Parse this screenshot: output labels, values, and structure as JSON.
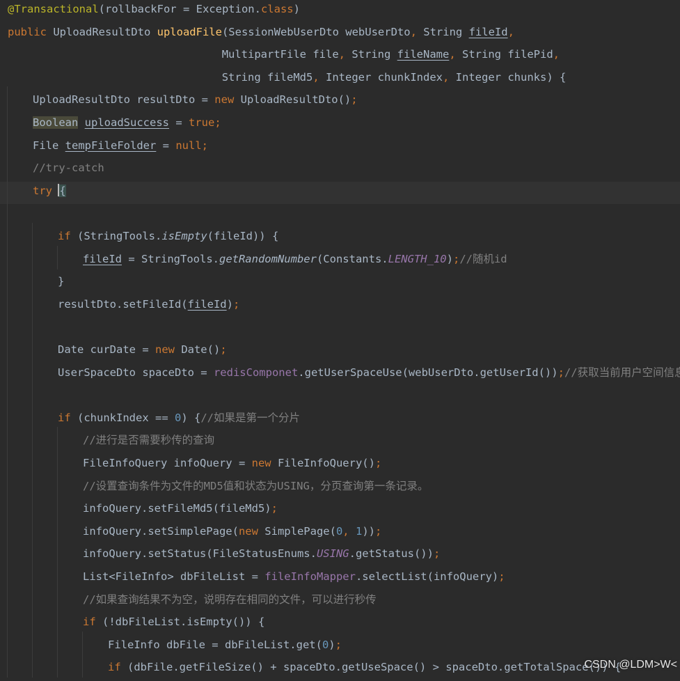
{
  "editor": {
    "lines": [
      {
        "indent": 0,
        "tokens": [
          {
            "t": "@Transactional",
            "c": "ann"
          },
          {
            "t": "(rollbackFor = Exception."
          },
          {
            "t": "class",
            "c": "kw"
          },
          {
            "t": ")"
          }
        ]
      },
      {
        "indent": 0,
        "tokens": [
          {
            "t": "public ",
            "c": "kw"
          },
          {
            "t": "UploadResultDto "
          },
          {
            "t": "uploadFile",
            "c": "fn"
          },
          {
            "t": "(SessionWebUserDto webUserDto"
          },
          {
            "t": ", ",
            "c": "kw"
          },
          {
            "t": "String "
          },
          {
            "t": "fileId",
            "c": "ul"
          },
          {
            "t": ",",
            "c": "kw"
          }
        ]
      },
      {
        "indent": 0,
        "col": 34,
        "tokens": [
          {
            "t": "MultipartFile file"
          },
          {
            "t": ", ",
            "c": "kw"
          },
          {
            "t": "String "
          },
          {
            "t": "fileName",
            "c": "ul"
          },
          {
            "t": ", ",
            "c": "kw"
          },
          {
            "t": "String filePid"
          },
          {
            "t": ",",
            "c": "kw"
          }
        ]
      },
      {
        "indent": 0,
        "col": 34,
        "tokens": [
          {
            "t": "String fileMd5"
          },
          {
            "t": ", ",
            "c": "kw"
          },
          {
            "t": "Integer chunkIndex"
          },
          {
            "t": ", ",
            "c": "kw"
          },
          {
            "t": "Integer chunks) {"
          }
        ]
      },
      {
        "indent": 1,
        "tokens": [
          {
            "t": "UploadResultDto resultDto = "
          },
          {
            "t": "new ",
            "c": "kw"
          },
          {
            "t": "UploadResultDto()"
          },
          {
            "t": ";",
            "c": "kw"
          }
        ]
      },
      {
        "indent": 1,
        "tokens": [
          {
            "t": "Boolean",
            "c": "hl"
          },
          {
            "t": " "
          },
          {
            "t": "uploadSuccess",
            "c": "ul"
          },
          {
            "t": " = "
          },
          {
            "t": "true;",
            "c": "kw"
          }
        ]
      },
      {
        "indent": 1,
        "tokens": [
          {
            "t": "File "
          },
          {
            "t": "tempFileFolder",
            "c": "ul"
          },
          {
            "t": " = "
          },
          {
            "t": "null;",
            "c": "kw"
          }
        ]
      },
      {
        "indent": 1,
        "tokens": [
          {
            "t": "//try-catch",
            "c": "cm"
          }
        ]
      },
      {
        "indent": 1,
        "current": true,
        "tokens": [
          {
            "t": "try ",
            "c": "kw"
          },
          {
            "t": "{",
            "c": "brace",
            "caret": true
          }
        ]
      },
      {
        "indent": 1,
        "tokens": []
      },
      {
        "indent": 2,
        "tokens": [
          {
            "t": "if ",
            "c": "kw"
          },
          {
            "t": "(StringTools."
          },
          {
            "t": "isEmpty",
            "c": "it"
          },
          {
            "t": "(fileId)) {"
          }
        ]
      },
      {
        "indent": 3,
        "tokens": [
          {
            "t": "fileId",
            "c": "ul"
          },
          {
            "t": " = StringTools."
          },
          {
            "t": "getRandomNumber",
            "c": "it"
          },
          {
            "t": "(Constants."
          },
          {
            "t": "LENGTH_10",
            "c": "static"
          },
          {
            "t": ")"
          },
          {
            "t": ";",
            "c": "kw"
          },
          {
            "t": "//随机id",
            "c": "cm"
          }
        ]
      },
      {
        "indent": 2,
        "tokens": [
          {
            "t": "}"
          }
        ]
      },
      {
        "indent": 2,
        "tokens": [
          {
            "t": "resultDto.setFileId("
          },
          {
            "t": "fileId",
            "c": "ul"
          },
          {
            "t": ")"
          },
          {
            "t": ";",
            "c": "kw"
          }
        ]
      },
      {
        "indent": 2,
        "tokens": []
      },
      {
        "indent": 2,
        "tokens": [
          {
            "t": "Date curDate = "
          },
          {
            "t": "new ",
            "c": "kw"
          },
          {
            "t": "Date()"
          },
          {
            "t": ";",
            "c": "kw"
          }
        ]
      },
      {
        "indent": 2,
        "tokens": [
          {
            "t": "UserSpaceDto spaceDto = "
          },
          {
            "t": "redisComponet",
            "c": "field"
          },
          {
            "t": ".getUserSpaceUse(webUserDto.getUserId())"
          },
          {
            "t": ";",
            "c": "kw"
          },
          {
            "t": "//获取当前用户空间信息",
            "c": "cm"
          }
        ]
      },
      {
        "indent": 2,
        "tokens": []
      },
      {
        "indent": 2,
        "tokens": [
          {
            "t": "if ",
            "c": "kw"
          },
          {
            "t": "(chunkIndex == "
          },
          {
            "t": "0",
            "c": "num"
          },
          {
            "t": ") {"
          },
          {
            "t": "//如果是第一个分片",
            "c": "cm"
          }
        ]
      },
      {
        "indent": 3,
        "tokens": [
          {
            "t": "//进行是否需要秒传的查询",
            "c": "cm"
          }
        ]
      },
      {
        "indent": 3,
        "tokens": [
          {
            "t": "FileInfoQuery infoQuery = "
          },
          {
            "t": "new ",
            "c": "kw"
          },
          {
            "t": "FileInfoQuery()"
          },
          {
            "t": ";",
            "c": "kw"
          }
        ]
      },
      {
        "indent": 3,
        "tokens": [
          {
            "t": "//设置查询条件为文件的MD5值和状态为USING，分页查询第一条记录。",
            "c": "cm"
          }
        ]
      },
      {
        "indent": 3,
        "tokens": [
          {
            "t": "infoQuery.setFileMd5(fileMd5)"
          },
          {
            "t": ";",
            "c": "kw"
          }
        ]
      },
      {
        "indent": 3,
        "tokens": [
          {
            "t": "infoQuery.setSimplePage("
          },
          {
            "t": "new ",
            "c": "kw"
          },
          {
            "t": "SimplePage("
          },
          {
            "t": "0",
            "c": "num"
          },
          {
            "t": ", ",
            "c": "kw"
          },
          {
            "t": "1",
            "c": "num"
          },
          {
            "t": "))"
          },
          {
            "t": ";",
            "c": "kw"
          }
        ]
      },
      {
        "indent": 3,
        "tokens": [
          {
            "t": "infoQuery.setStatus(FileStatusEnums."
          },
          {
            "t": "USING",
            "c": "static"
          },
          {
            "t": ".getStatus())"
          },
          {
            "t": ";",
            "c": "kw"
          }
        ]
      },
      {
        "indent": 3,
        "tokens": [
          {
            "t": "List<FileInfo> dbFileList = "
          },
          {
            "t": "fileInfoMapper",
            "c": "field"
          },
          {
            "t": ".selectList(infoQuery)"
          },
          {
            "t": ";",
            "c": "kw"
          }
        ]
      },
      {
        "indent": 3,
        "tokens": [
          {
            "t": "//如果查询结果不为空，说明存在相同的文件，可以进行秒传",
            "c": "cm"
          }
        ]
      },
      {
        "indent": 3,
        "tokens": [
          {
            "t": "if ",
            "c": "kw"
          },
          {
            "t": "(!dbFileList.isEmpty()) {"
          }
        ]
      },
      {
        "indent": 4,
        "tokens": [
          {
            "t": "FileInfo dbFile = dbFileList.get("
          },
          {
            "t": "0",
            "c": "num"
          },
          {
            "t": ")"
          },
          {
            "t": ";",
            "c": "kw"
          }
        ]
      },
      {
        "indent": 4,
        "tokens": [
          {
            "t": "if ",
            "c": "kw"
          },
          {
            "t": "(dbFile.getFileSize() + spaceDto.getUseSpace() > spaceDto.getTotalSpace()) {"
          }
        ]
      }
    ]
  },
  "watermark": "CSDN @LDM>W<"
}
